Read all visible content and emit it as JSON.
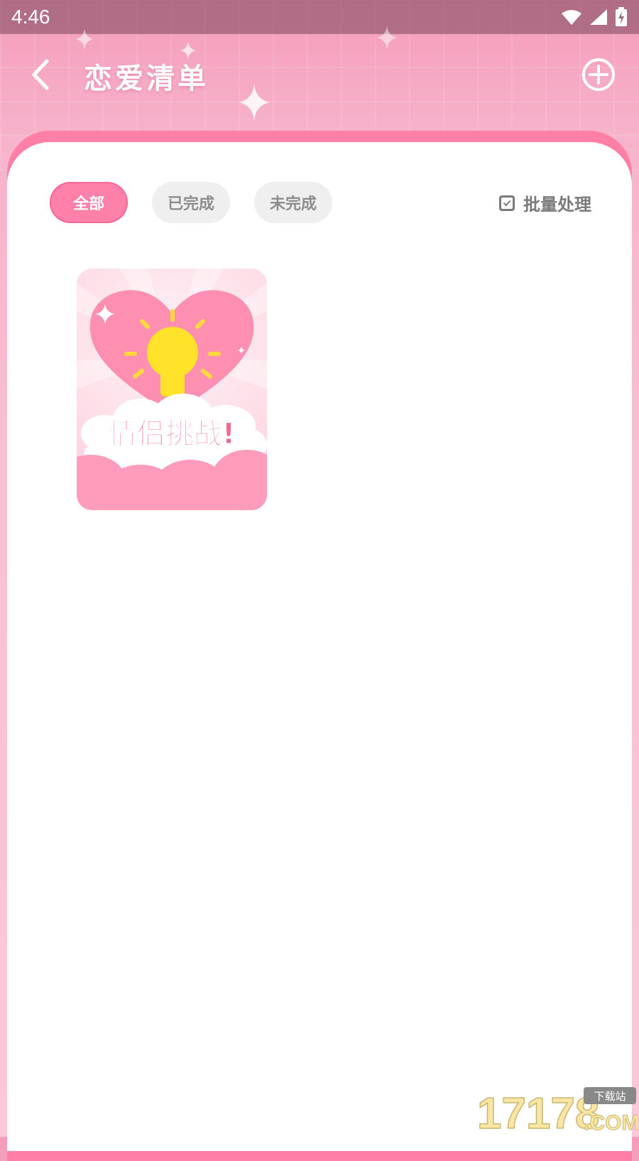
{
  "status_bar": {
    "time": "4:46"
  },
  "header": {
    "title": "恋爱清单"
  },
  "filters": [
    {
      "label": "全部",
      "active": true
    },
    {
      "label": "已完成",
      "active": false
    },
    {
      "label": "未完成",
      "active": false
    }
  ],
  "batch": {
    "label": "批量处理"
  },
  "items": [
    {
      "title": "情侣挑战!"
    }
  ],
  "watermark": {
    "main": "17178",
    "sub": "下载站",
    "domain": ".COM"
  },
  "colors": {
    "accent": "#ff80a8",
    "header_pink": "#f49cba",
    "chip_bg": "#efefef"
  }
}
